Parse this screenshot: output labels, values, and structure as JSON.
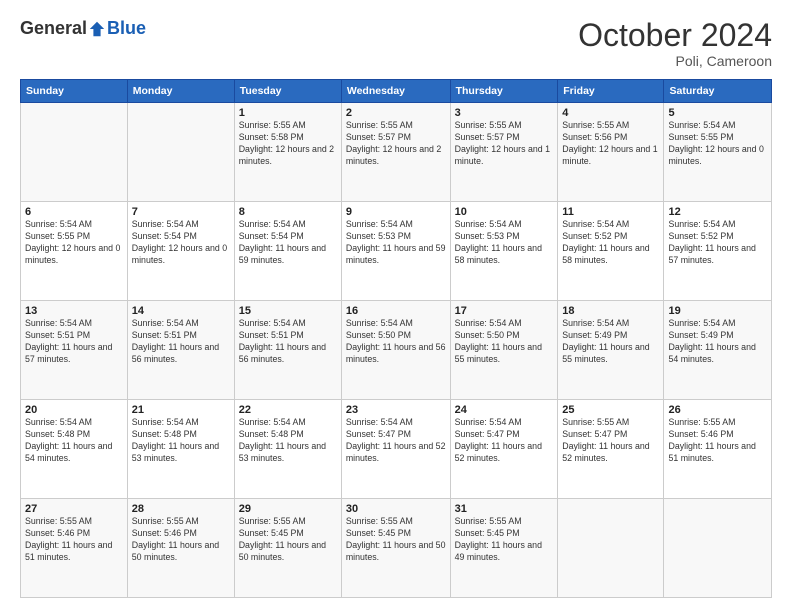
{
  "header": {
    "logo_general": "General",
    "logo_blue": "Blue",
    "month_title": "October 2024",
    "location": "Poli, Cameroon"
  },
  "days_of_week": [
    "Sunday",
    "Monday",
    "Tuesday",
    "Wednesday",
    "Thursday",
    "Friday",
    "Saturday"
  ],
  "weeks": [
    [
      {
        "day": "",
        "info": ""
      },
      {
        "day": "",
        "info": ""
      },
      {
        "day": "1",
        "info": "Sunrise: 5:55 AM\nSunset: 5:58 PM\nDaylight: 12 hours and 2 minutes."
      },
      {
        "day": "2",
        "info": "Sunrise: 5:55 AM\nSunset: 5:57 PM\nDaylight: 12 hours and 2 minutes."
      },
      {
        "day": "3",
        "info": "Sunrise: 5:55 AM\nSunset: 5:57 PM\nDaylight: 12 hours and 1 minute."
      },
      {
        "day": "4",
        "info": "Sunrise: 5:55 AM\nSunset: 5:56 PM\nDaylight: 12 hours and 1 minute."
      },
      {
        "day": "5",
        "info": "Sunrise: 5:54 AM\nSunset: 5:55 PM\nDaylight: 12 hours and 0 minutes."
      }
    ],
    [
      {
        "day": "6",
        "info": "Sunrise: 5:54 AM\nSunset: 5:55 PM\nDaylight: 12 hours and 0 minutes."
      },
      {
        "day": "7",
        "info": "Sunrise: 5:54 AM\nSunset: 5:54 PM\nDaylight: 12 hours and 0 minutes."
      },
      {
        "day": "8",
        "info": "Sunrise: 5:54 AM\nSunset: 5:54 PM\nDaylight: 11 hours and 59 minutes."
      },
      {
        "day": "9",
        "info": "Sunrise: 5:54 AM\nSunset: 5:53 PM\nDaylight: 11 hours and 59 minutes."
      },
      {
        "day": "10",
        "info": "Sunrise: 5:54 AM\nSunset: 5:53 PM\nDaylight: 11 hours and 58 minutes."
      },
      {
        "day": "11",
        "info": "Sunrise: 5:54 AM\nSunset: 5:52 PM\nDaylight: 11 hours and 58 minutes."
      },
      {
        "day": "12",
        "info": "Sunrise: 5:54 AM\nSunset: 5:52 PM\nDaylight: 11 hours and 57 minutes."
      }
    ],
    [
      {
        "day": "13",
        "info": "Sunrise: 5:54 AM\nSunset: 5:51 PM\nDaylight: 11 hours and 57 minutes."
      },
      {
        "day": "14",
        "info": "Sunrise: 5:54 AM\nSunset: 5:51 PM\nDaylight: 11 hours and 56 minutes."
      },
      {
        "day": "15",
        "info": "Sunrise: 5:54 AM\nSunset: 5:51 PM\nDaylight: 11 hours and 56 minutes."
      },
      {
        "day": "16",
        "info": "Sunrise: 5:54 AM\nSunset: 5:50 PM\nDaylight: 11 hours and 56 minutes."
      },
      {
        "day": "17",
        "info": "Sunrise: 5:54 AM\nSunset: 5:50 PM\nDaylight: 11 hours and 55 minutes."
      },
      {
        "day": "18",
        "info": "Sunrise: 5:54 AM\nSunset: 5:49 PM\nDaylight: 11 hours and 55 minutes."
      },
      {
        "day": "19",
        "info": "Sunrise: 5:54 AM\nSunset: 5:49 PM\nDaylight: 11 hours and 54 minutes."
      }
    ],
    [
      {
        "day": "20",
        "info": "Sunrise: 5:54 AM\nSunset: 5:48 PM\nDaylight: 11 hours and 54 minutes."
      },
      {
        "day": "21",
        "info": "Sunrise: 5:54 AM\nSunset: 5:48 PM\nDaylight: 11 hours and 53 minutes."
      },
      {
        "day": "22",
        "info": "Sunrise: 5:54 AM\nSunset: 5:48 PM\nDaylight: 11 hours and 53 minutes."
      },
      {
        "day": "23",
        "info": "Sunrise: 5:54 AM\nSunset: 5:47 PM\nDaylight: 11 hours and 52 minutes."
      },
      {
        "day": "24",
        "info": "Sunrise: 5:54 AM\nSunset: 5:47 PM\nDaylight: 11 hours and 52 minutes."
      },
      {
        "day": "25",
        "info": "Sunrise: 5:55 AM\nSunset: 5:47 PM\nDaylight: 11 hours and 52 minutes."
      },
      {
        "day": "26",
        "info": "Sunrise: 5:55 AM\nSunset: 5:46 PM\nDaylight: 11 hours and 51 minutes."
      }
    ],
    [
      {
        "day": "27",
        "info": "Sunrise: 5:55 AM\nSunset: 5:46 PM\nDaylight: 11 hours and 51 minutes."
      },
      {
        "day": "28",
        "info": "Sunrise: 5:55 AM\nSunset: 5:46 PM\nDaylight: 11 hours and 50 minutes."
      },
      {
        "day": "29",
        "info": "Sunrise: 5:55 AM\nSunset: 5:45 PM\nDaylight: 11 hours and 50 minutes."
      },
      {
        "day": "30",
        "info": "Sunrise: 5:55 AM\nSunset: 5:45 PM\nDaylight: 11 hours and 50 minutes."
      },
      {
        "day": "31",
        "info": "Sunrise: 5:55 AM\nSunset: 5:45 PM\nDaylight: 11 hours and 49 minutes."
      },
      {
        "day": "",
        "info": ""
      },
      {
        "day": "",
        "info": ""
      }
    ]
  ]
}
